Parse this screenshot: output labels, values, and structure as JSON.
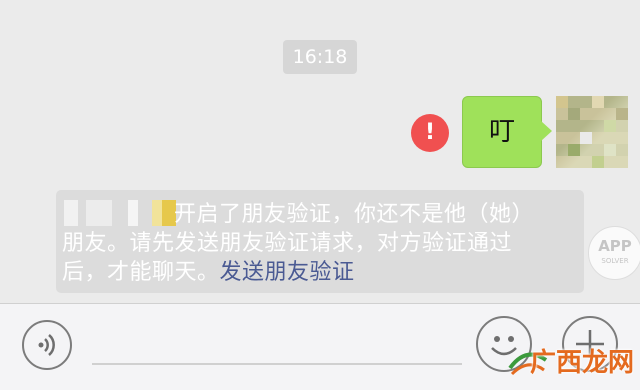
{
  "chat": {
    "timestamp": "16:18",
    "sent_message": "叮",
    "send_error_icon": "exclamation-icon",
    "notice": {
      "text_line1": "开启了朋友验证，你还不是他（她）",
      "text_line2": "朋友。请先发送朋友验证请求，对方验证通过",
      "text_line3": "后，才能聊天。",
      "link": "发送朋友验证"
    }
  },
  "input_bar": {
    "voice_icon": "voice-icon",
    "emoji_icon": "smiley-icon",
    "more_icon": "plus-icon"
  },
  "watermarks": {
    "app_badge_top": "APP",
    "app_badge_bottom": "SOLVER",
    "site_text": "广西龙网"
  },
  "colors": {
    "background": "#ebebeb",
    "sent_bubble": "#9fe15a",
    "error": "#f05050",
    "link": "#4a5a93",
    "notice_bg": "#dcdcdc"
  }
}
